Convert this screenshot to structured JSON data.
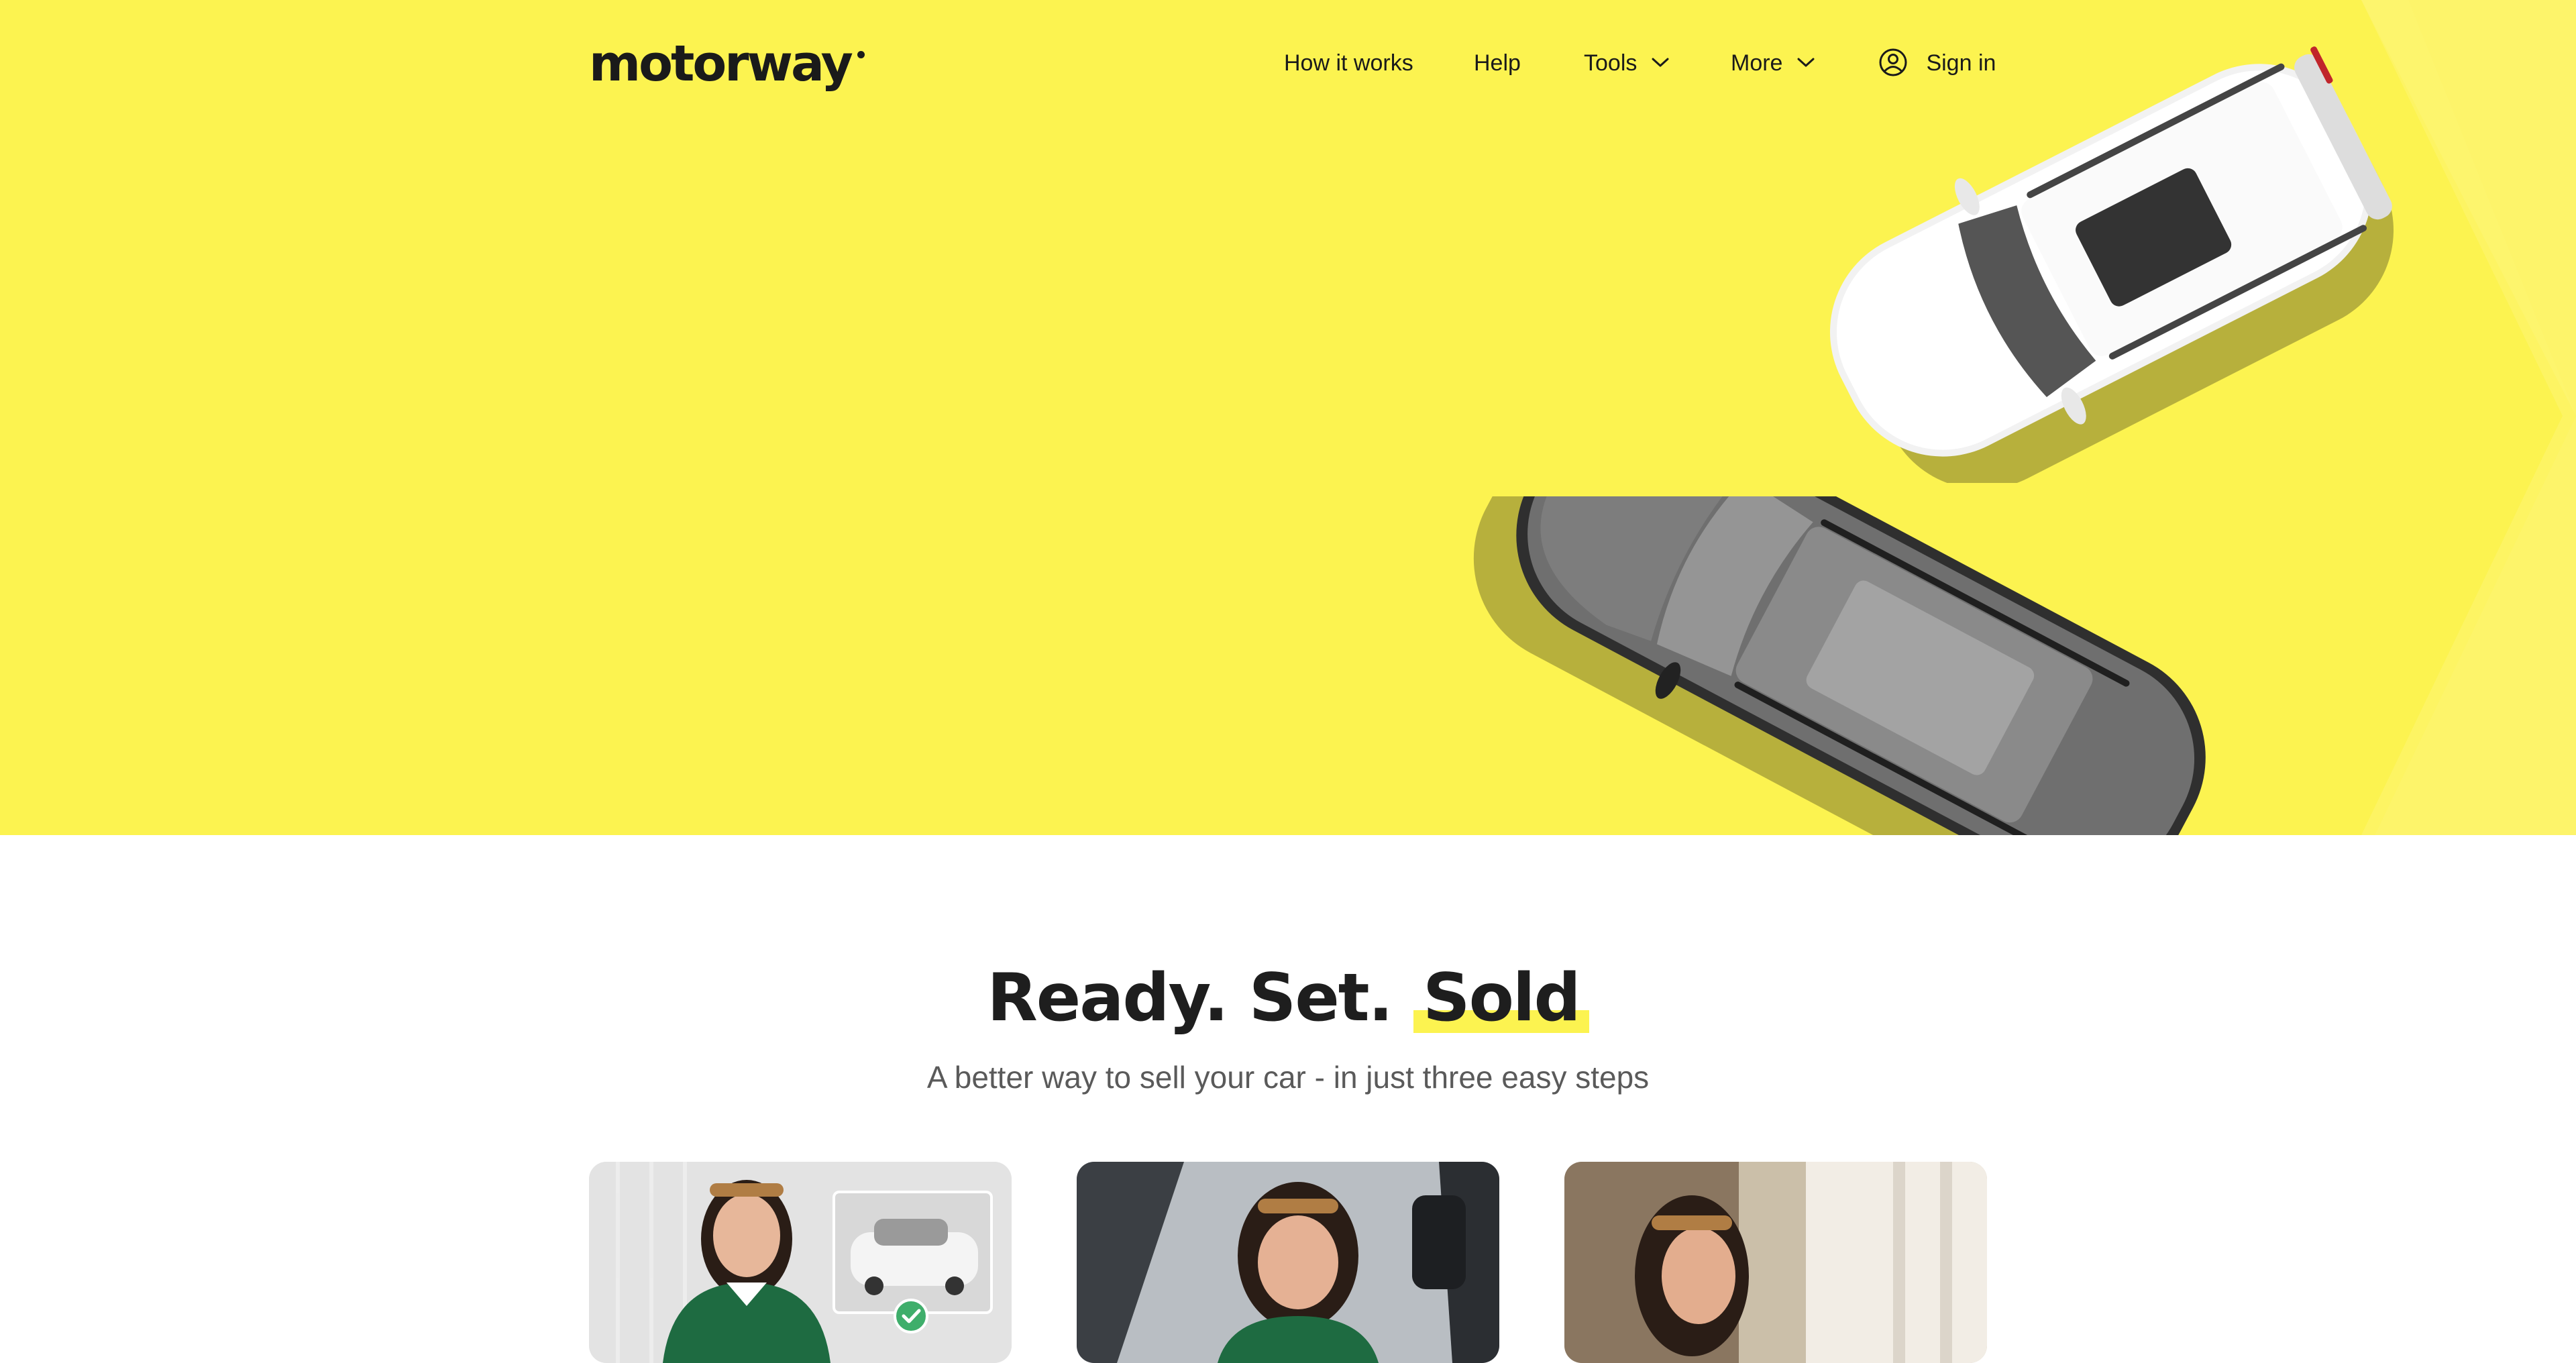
{
  "brand": {
    "name": "motorway",
    "accent_color": "#fcf350"
  },
  "nav": {
    "items": [
      {
        "label": "How it works",
        "icon": null
      },
      {
        "label": "Help",
        "icon": null
      },
      {
        "label": "Tools",
        "icon": "chevron-down-icon"
      },
      {
        "label": "More",
        "icon": "chevron-down-icon"
      }
    ],
    "signin": {
      "label": "Sign in",
      "icon": "user-icon"
    }
  },
  "steps": {
    "title_prefix": "Ready. Set.",
    "title_highlight": "Sold",
    "subtitle": "A better way to sell your car - in just three easy steps"
  }
}
